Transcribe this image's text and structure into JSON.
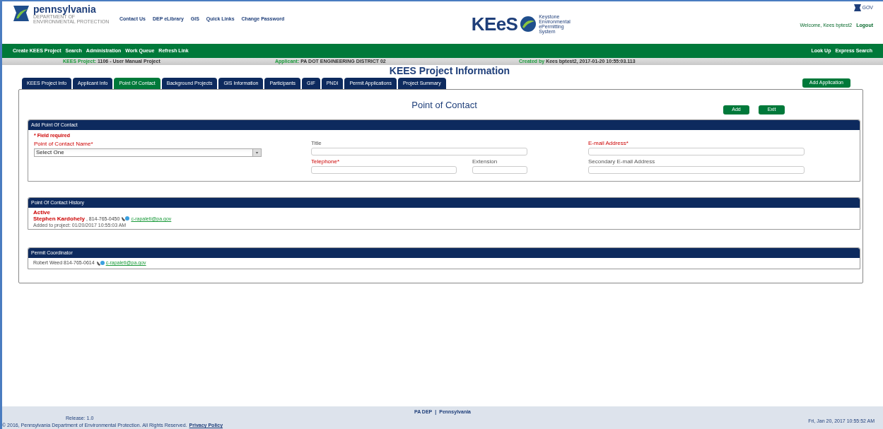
{
  "header": {
    "agency": "pennsylvania",
    "agency_sub": "DEPARTMENT OF ENVIRONMENTAL PROTECTION",
    "links": [
      "Contact Us",
      "DEP eLibrary",
      "GIS",
      "Quick Links",
      "Change Password"
    ],
    "logo_text": "KEeS",
    "logo_lines": [
      "Keystone",
      "Environmental",
      "ePermitting",
      "System"
    ],
    "gov_label": "GOV",
    "welcome": "Welcome, Kees bptest2",
    "logout": "Logout"
  },
  "nav": {
    "left": [
      "Create KEES Project",
      "Search",
      "Administration",
      "Work Queue",
      "Refresh Link"
    ],
    "right": [
      "Look Up",
      "Express Search"
    ]
  },
  "info_bar": [
    {
      "label": "KEES Project:",
      "value": "1106 - User Manual Project"
    },
    {
      "label": "Applicant:",
      "value": "PA DOT ENGINEERING DISTRICT 02"
    },
    {
      "label": "Created by",
      "value": "Kees bptest2, 2017-01-20 10:55:03.113"
    }
  ],
  "page_title": "KEES Project Information",
  "tabs": [
    {
      "label": "KEES Project Info",
      "selected": false
    },
    {
      "label": "Applicant Info",
      "selected": false
    },
    {
      "label": "Point Of Contact",
      "selected": true
    },
    {
      "label": "Background Projects",
      "selected": false
    },
    {
      "label": "GIS Information",
      "selected": false
    },
    {
      "label": "Participants",
      "selected": false
    },
    {
      "label": "GIF",
      "selected": false
    },
    {
      "label": "PNDI",
      "selected": false
    },
    {
      "label": "Permit Applications",
      "selected": false
    },
    {
      "label": "Project Summary",
      "selected": false
    }
  ],
  "add_application": "Add Application",
  "section_title": "Point of Contact",
  "actions": [
    "Add",
    "Exit"
  ],
  "add_panel": {
    "title": "Add Point Of Contact",
    "required_note": "* Field required",
    "contact_name": {
      "label": "Point of Contact Name*",
      "value": "Select One",
      "required": true
    },
    "title_field": {
      "label": "Title",
      "required": false
    },
    "email": {
      "label": "E-mail Address*",
      "required": true
    },
    "telephone": {
      "label": "Telephone*",
      "required": true
    },
    "extension": {
      "label": "Extension",
      "required": false
    },
    "secondary_email": {
      "label": "Secondary E-mail Address",
      "required": false
    }
  },
  "history": {
    "title": "Point Of Contact History",
    "status": "Active",
    "name": "Stephen Kardohely",
    "phone": ", 814-765-0450",
    "email": "c-rapaleti@pa.gov",
    "added": "Added to project: 01/20/2017 10:55:03 AM"
  },
  "coordinator": {
    "title": "Permit Coordinator",
    "name_phone": "Robert Weed 814-765-0614",
    "email": "c-rapaleti@pa.gov"
  },
  "footer": {
    "links": [
      "PA DEP",
      "|",
      "Pennsylvania"
    ],
    "release": "Release: 1.0",
    "copyright": "© 2016, Pennsylvania Department of Environmental Protection. All Rights Reserved.",
    "privacy": "Privacy Policy",
    "timestamp": "Fri, Jan 20, 2017 10:55:52 AM"
  }
}
